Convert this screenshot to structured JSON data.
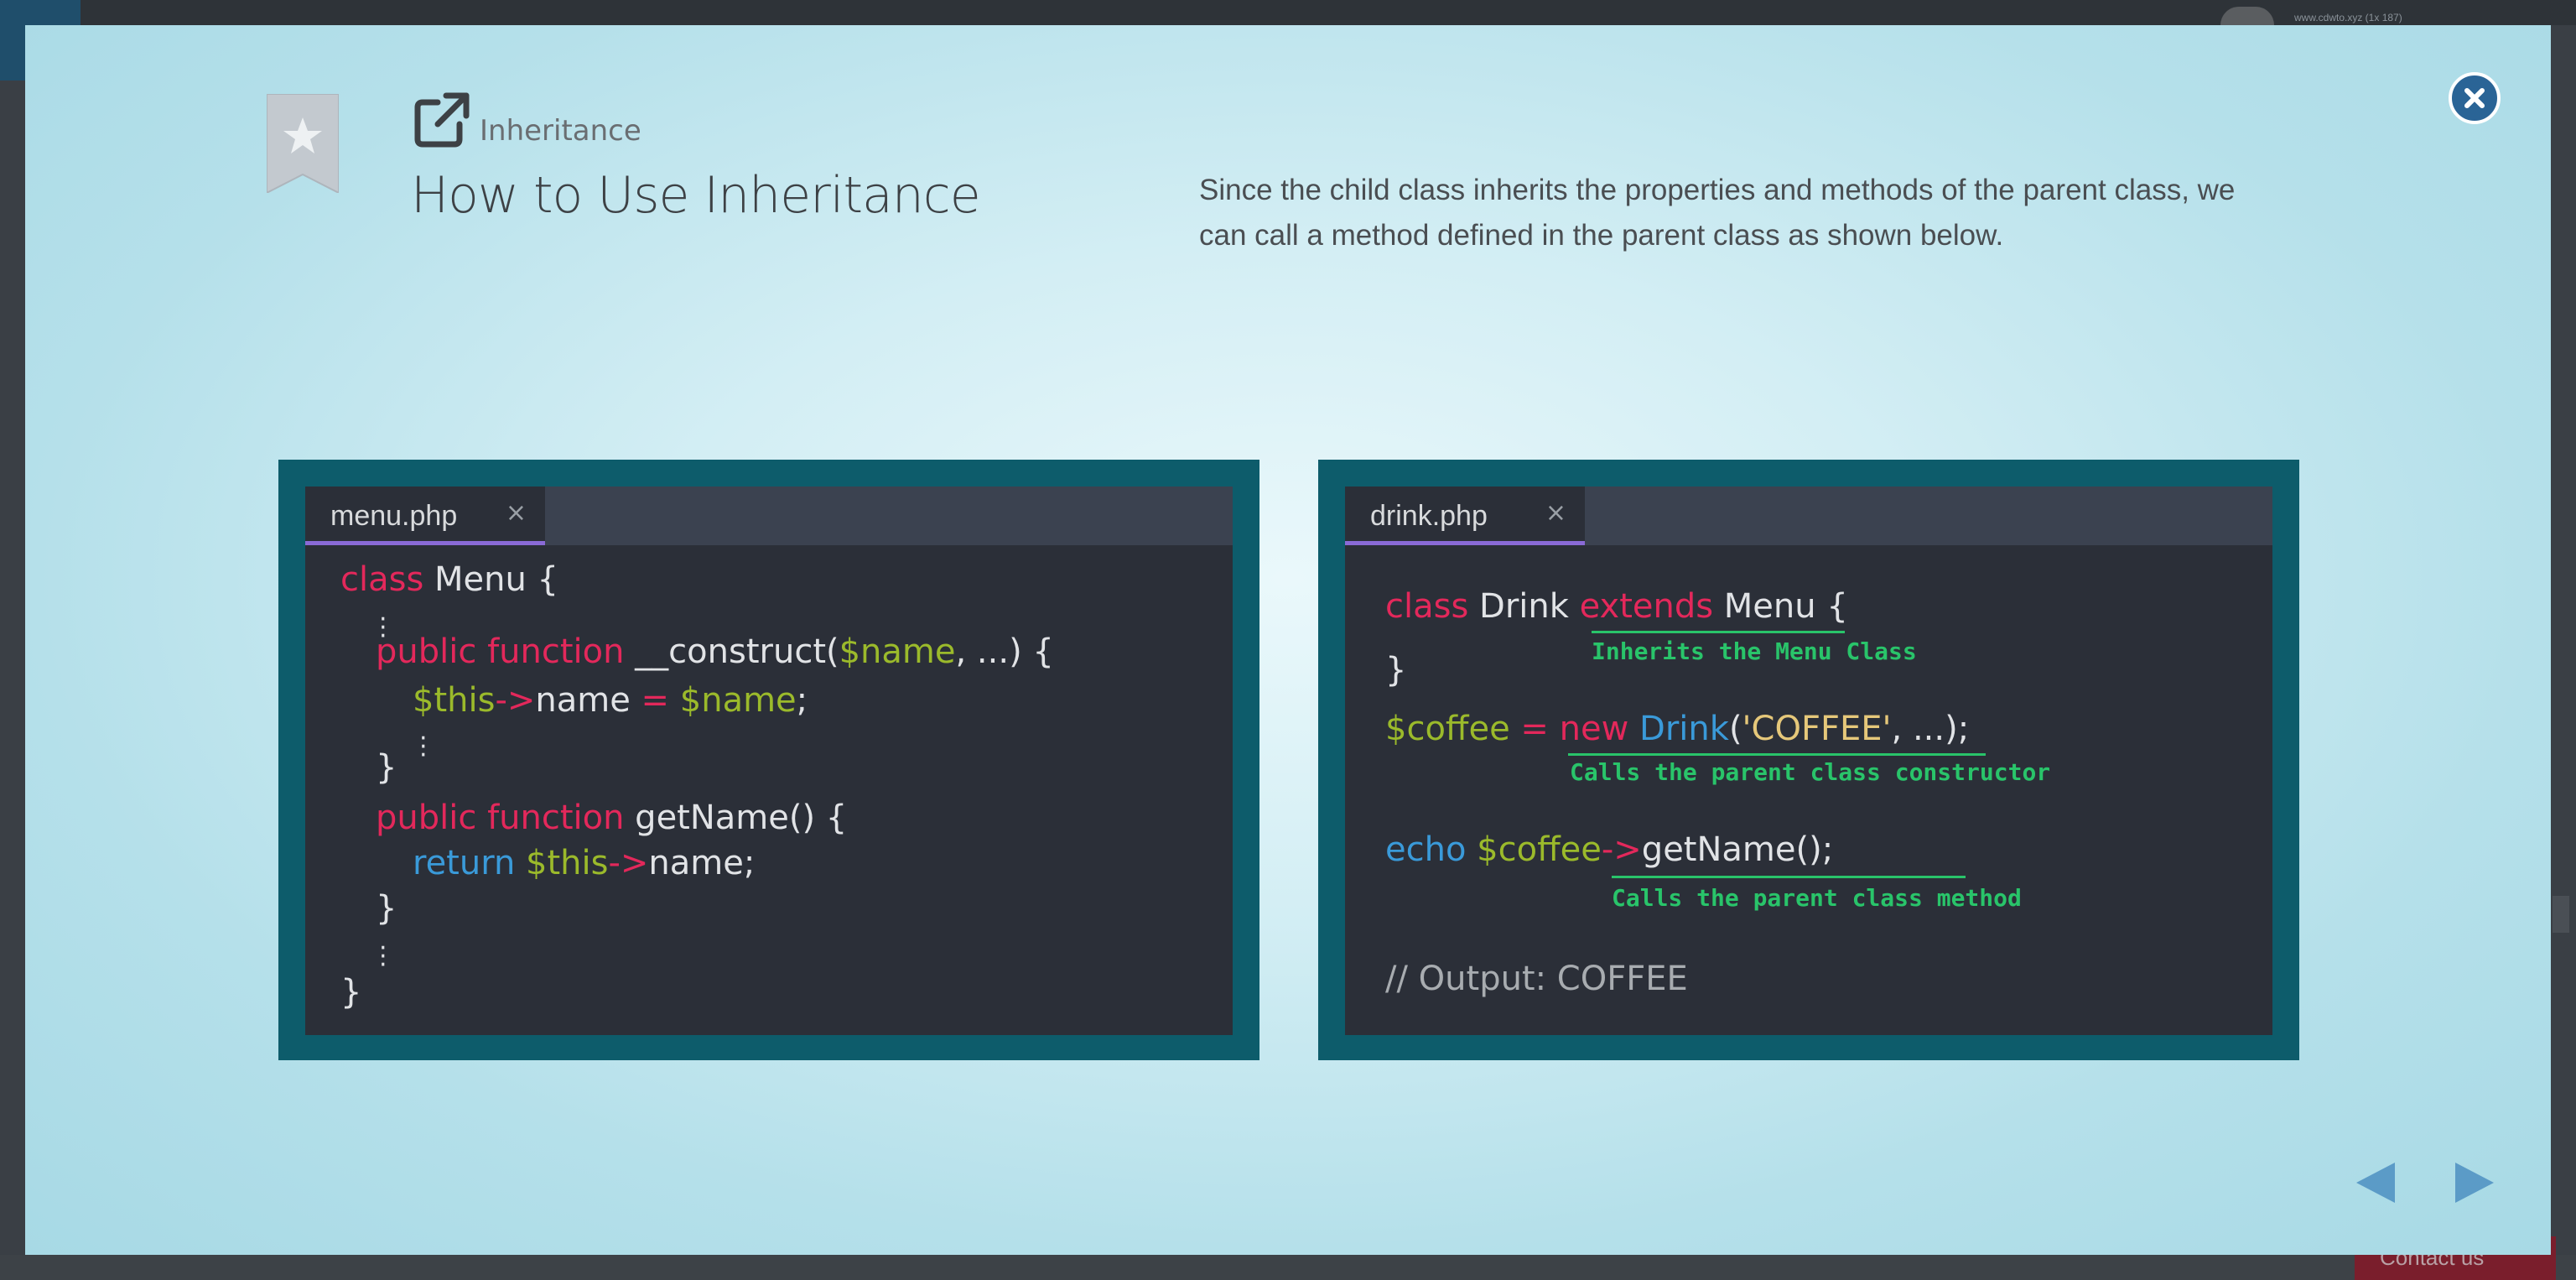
{
  "background": {
    "url_text": "www.cdwto.xyz (1x 187)",
    "contact_label": "Contact us"
  },
  "header": {
    "breadcrumb": "Inheritance",
    "title": "How to Use Inheritance",
    "description": "Since the child class inherits the properties and methods of the parent class, we can call a method defined in the parent class as shown below."
  },
  "left_editor": {
    "tab_label": "menu.php",
    "tab_close": "×",
    "lines": {
      "l1_k": "class",
      "l1_rest": " Menu {",
      "l2_k": "public function",
      "l2_mid": " __construct(",
      "l2_v": "$name",
      "l2_end": ", ...) {",
      "l3_v": "$this",
      "l3_arrow": "->",
      "l3_mid": "name ",
      "l3_eq": "=",
      "l3_v2": " $name",
      "l3_end": ";",
      "l4": "}",
      "l5_k": "public function",
      "l5_rest": " getName() {",
      "l6_b": "return",
      "l6_v": " $this",
      "l6_arrow": "->",
      "l6_rest": "name;",
      "l7": "}",
      "l8": "}"
    }
  },
  "right_editor": {
    "tab_label": "drink.php",
    "tab_close": "×",
    "lines": {
      "l1_k": "class",
      "l1_mid": " Drink ",
      "l1_k2": "extends",
      "l1_rest": " Menu {",
      "l2": "}",
      "l3_v": "$coffee",
      "l3_eq": " = ",
      "l3_k": "new",
      "l3_b": " Drink",
      "l3_p": "(",
      "l3_s": "'COFFEE'",
      "l3_end": ", ...);",
      "l4_b": "echo",
      "l4_v": " $coffee",
      "l4_arrow": "->",
      "l4_rest": "getName();",
      "l5": "// Output: COFFEE"
    },
    "notes": {
      "inherits": "Inherits the Menu Class",
      "constructor": "Calls the parent class constructor",
      "method": "Calls the parent class method"
    }
  },
  "colors": {
    "keyword": "#e3285b",
    "variable": "#9bba2b",
    "builtin": "#3a9ad9",
    "string": "#e6c87a",
    "annotation": "#29c46a",
    "panel_frame": "#0d5c6b",
    "editor_bg": "#2b2f38",
    "close_button": "#2a6496",
    "nav_arrow": "#5b9bc7"
  },
  "icons": {
    "bookmark": "bookmark-star-icon",
    "external": "external-link-icon",
    "close": "close-icon",
    "prev": "prev-arrow-icon",
    "next": "next-arrow-icon"
  }
}
